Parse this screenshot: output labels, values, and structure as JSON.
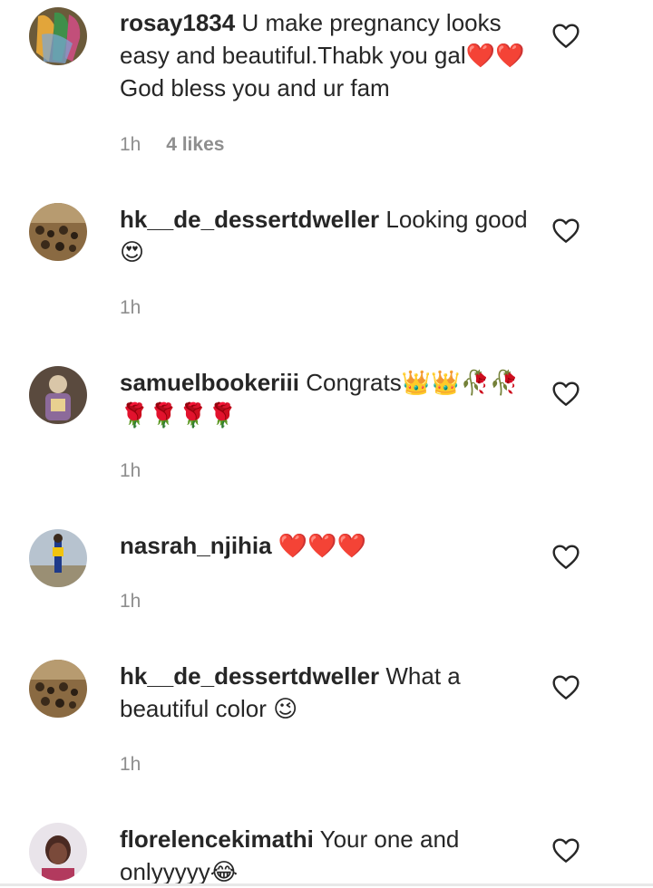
{
  "comments": [
    {
      "username": "rosay1834",
      "text": "U make pregnancy looks easy and beautiful.Thabk you gal❤️❤️ God bless you and ur fam",
      "time": "1h",
      "likes": "4 likes"
    },
    {
      "username": "hk__de_dessertdweller",
      "text": "Looking good 😍",
      "time": "1h"
    },
    {
      "username": "samuelbookeriii",
      "text": "Congrats👑👑🥀🥀🌹🌹🌹🌹",
      "time": "1h"
    },
    {
      "username": "nasrah_njihia",
      "text": "❤️❤️❤️",
      "time": "1h"
    },
    {
      "username": "hk__de_dessertdweller",
      "text": "What a beautiful color 😉",
      "time": "1h"
    },
    {
      "username": "florelencekimathi",
      "text": "Your one and onlyyyyy😂",
      "time": ""
    }
  ],
  "icons": {
    "like": "heart-outline-icon",
    "avatar": "user-avatar"
  },
  "colors": {
    "text": "#262626",
    "meta": "#8e8e8e",
    "heart": "#262626"
  }
}
